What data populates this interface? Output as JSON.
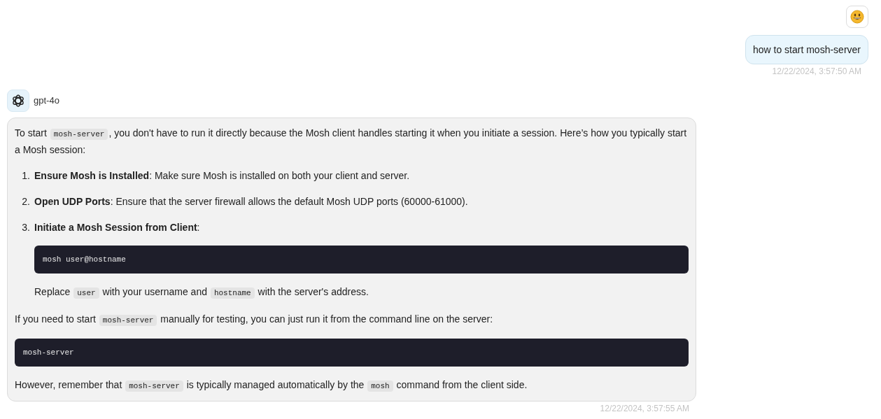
{
  "user_message": {
    "text": "how to start mosh-server",
    "time": "12/22/2024, 3:57:50 AM"
  },
  "assistant_message": {
    "model": "gpt-4o",
    "time": "12/22/2024, 3:57:55 AM",
    "blocks": [
      {
        "kind": "paragraph",
        "segments": [
          {
            "kind": "text",
            "text": "To start "
          },
          {
            "kind": "code",
            "text": "mosh-server"
          },
          {
            "kind": "text",
            "text": ", you don't have to run it directly because the Mosh client handles starting it when you initiate a session. Here’s how you typically start a Mosh session:"
          }
        ]
      },
      {
        "kind": "list",
        "items": [
          {
            "number": "1.",
            "segments": [
              {
                "kind": "text",
                "text": "**Ensure Mosh is Installed**: Make sure Mosh is installed on both your client and server."
              }
            ]
          },
          {
            "number": "2.",
            "segments": [
              {
                "kind": "text",
                "text": "**Open UDP Ports**: Ensure that the server firewall allows the default Mosh UDP ports (60000-61000)."
              }
            ]
          },
          {
            "number": "3.",
            "segments": [
              {
                "kind": "text",
                "text": "**Initiate a Mosh Session from Client**:"
              }
            ],
            "code_block": "mosh user@hostname",
            "note": [
              {
                "kind": "text",
                "text": "Replace "
              },
              {
                "kind": "code",
                "text": "user"
              },
              {
                "kind": "text",
                "text": " with your username and "
              },
              {
                "kind": "code",
                "text": "hostname"
              },
              {
                "kind": "text",
                "text": " with the server's address."
              }
            ]
          }
        ]
      },
      {
        "kind": "paragraph",
        "segments": [
          {
            "kind": "text",
            "text": "If you need to start "
          },
          {
            "kind": "code",
            "text": "mosh-server"
          },
          {
            "kind": "text",
            "text": " manually for testing, you can just run it from the command line on the server:"
          }
        ]
      },
      {
        "kind": "code_block",
        "text": "mosh-server"
      },
      {
        "kind": "paragraph",
        "segments": [
          {
            "kind": "text",
            "text": "However, remember that "
          },
          {
            "kind": "code",
            "text": "mosh-server"
          },
          {
            "kind": "text",
            "text": " is typically managed automatically by the "
          },
          {
            "kind": "code",
            "text": "mosh"
          },
          {
            "kind": "text",
            "text": " command from the client side."
          }
        ]
      }
    ]
  }
}
